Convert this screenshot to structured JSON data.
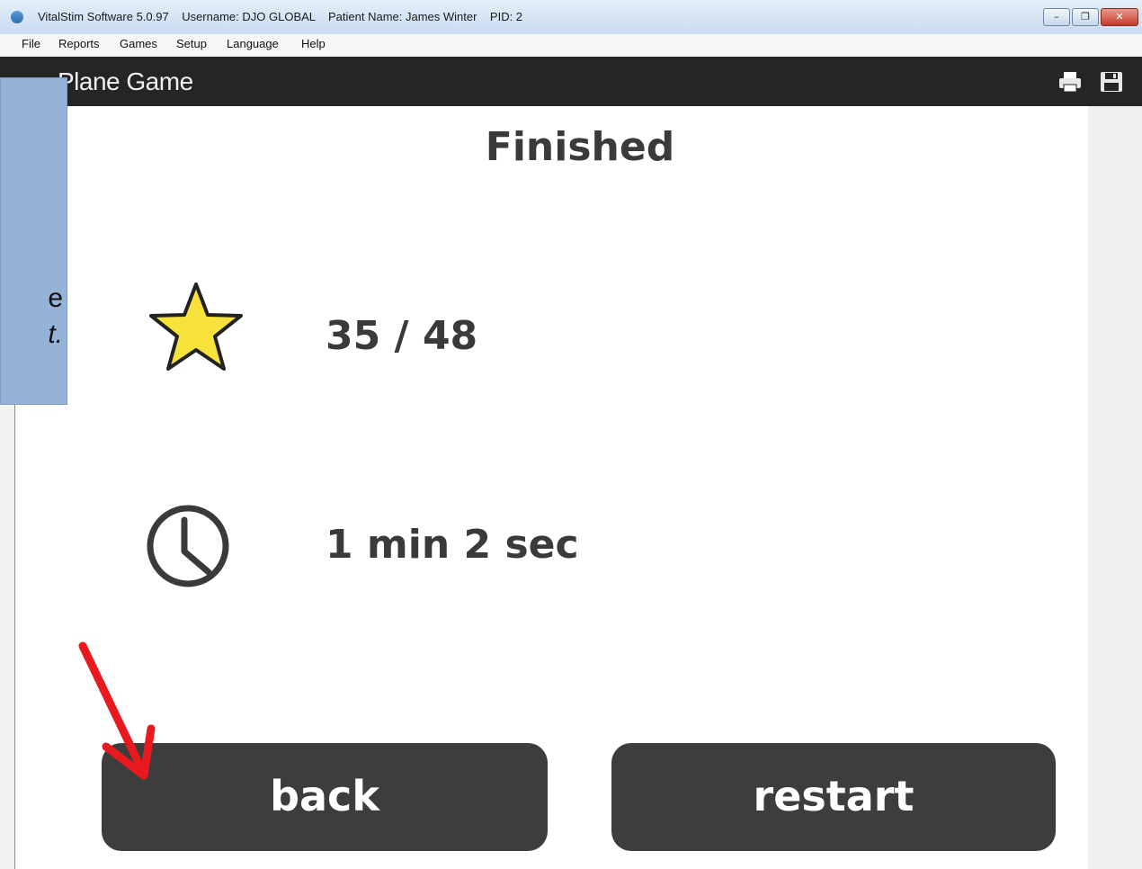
{
  "titlebar": {
    "app_name": "VitalStim Software 5.0.97",
    "username": "Username: DJO GLOBAL",
    "patient": "Patient Name: James Winter",
    "pid": "PID: 2",
    "minimize": "–",
    "maximize": "❐",
    "close": "✕"
  },
  "menu": [
    "File",
    "Reports",
    "Games",
    "Setup",
    "Language",
    "Help"
  ],
  "header": {
    "title": "Plane Game",
    "icons": [
      "printer-icon",
      "save-icon"
    ]
  },
  "side_panel": {
    "line1": "e",
    "line2": "t."
  },
  "results": {
    "heading": "Finished",
    "score": "35 / 48",
    "time": "1 min 2 sec",
    "score_icon": "star-icon",
    "time_icon": "clock-icon"
  },
  "buttons": {
    "back": "back",
    "restart": "restart"
  },
  "colors": {
    "header_bg": "#252525",
    "button_bg": "#3d3d3d",
    "star_fill": "#f7e23c",
    "arrow": "#e8191f",
    "side_panel": "#95b3d7"
  }
}
